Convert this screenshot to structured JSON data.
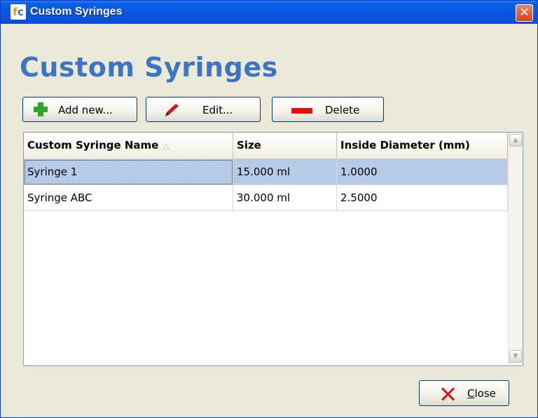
{
  "window": {
    "title": "Custom Syringes",
    "close_symbol": "✕",
    "app_icon": "fc-app-icon"
  },
  "heading": "Custom Syringes",
  "toolbar": {
    "add_label": "Add new...",
    "edit_label": "Edit...",
    "delete_label": "Delete"
  },
  "table": {
    "columns": [
      "Custom Syringe Name",
      "Size",
      "Inside Diameter (mm)"
    ],
    "sort_indicator": "△",
    "rows": [
      {
        "name": "Syringe 1",
        "size": "15.000 ml",
        "diameter": "1.0000"
      },
      {
        "name": "Syringe ABC",
        "size": "30.000 ml",
        "diameter": "2.5000"
      }
    ],
    "selected_row": 0
  },
  "footer": {
    "close_label_first": "C",
    "close_label_rest": "lose"
  },
  "colors": {
    "title_bar": "#0854e0",
    "heading": "#3c75c6",
    "selection": "#b6cbe8"
  }
}
